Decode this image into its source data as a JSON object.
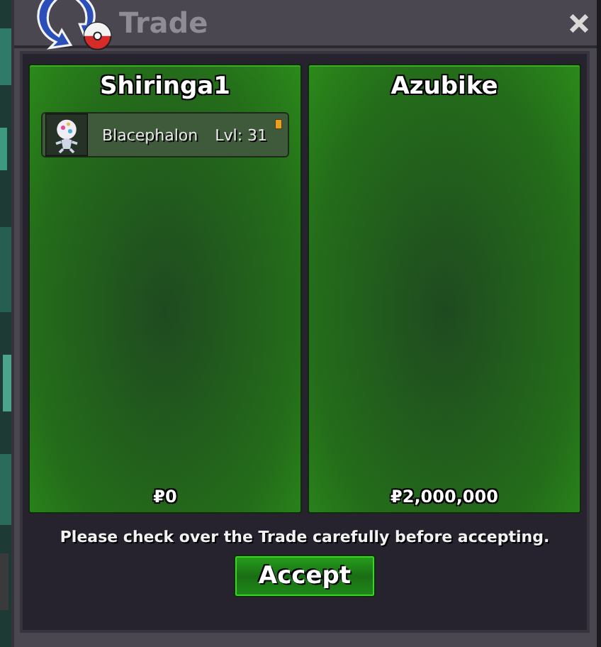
{
  "window": {
    "title": "Trade"
  },
  "offers": [
    {
      "trader": "Shiringa1",
      "pokemon": [
        {
          "name": "Blacephalon",
          "level": "Lvl: 31"
        }
      ],
      "money": "₽0"
    },
    {
      "trader": "Azubike",
      "money": "₽2,000,000"
    }
  ],
  "notice": "Please check over the Trade carefully before accepting.",
  "buttons": [
    "Accept"
  ]
}
